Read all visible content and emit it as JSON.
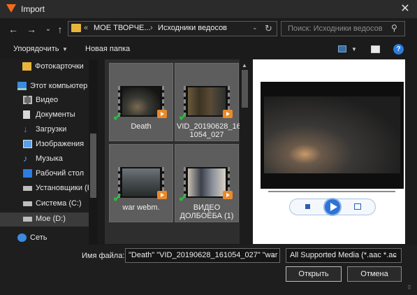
{
  "window": {
    "title": "Import",
    "close_glyph": "✕"
  },
  "nav": {
    "back_glyph": "←",
    "forward_glyph": "→",
    "recent_glyph": "⌄",
    "up_glyph": "↑",
    "path_prefix": "«",
    "path": [
      "МОЕ ТВОРЧЕ...",
      "Исходники ведосов"
    ],
    "path_separator": "›",
    "dropdown_glyph": "⌄",
    "refresh_glyph": "↻"
  },
  "search": {
    "placeholder": "Поиск: Исходники ведосов",
    "icon_glyph": "⚲"
  },
  "toolbar": {
    "organize": "Упорядочить",
    "organize_caret": "▼",
    "new_folder": "Новая папка",
    "view_caret": "▼",
    "help": "?"
  },
  "sidebar": {
    "items": [
      {
        "label": "Фотокарточки",
        "icon": "folder-icon"
      },
      {
        "label": "Этот компьютер",
        "icon": "computer-icon"
      },
      {
        "label": "Видео",
        "icon": "video-folder-icon"
      },
      {
        "label": "Документы",
        "icon": "documents-icon"
      },
      {
        "label": "Загрузки",
        "icon": "downloads-icon"
      },
      {
        "label": "Изображения",
        "icon": "pictures-icon"
      },
      {
        "label": "Музыка",
        "icon": "music-icon"
      },
      {
        "label": "Рабочий стол",
        "icon": "desktop-icon"
      },
      {
        "label": "Установщики (E",
        "icon": "drive-icon"
      },
      {
        "label": "Система (C:)",
        "icon": "drive-icon"
      },
      {
        "label": "Мое (D:)",
        "icon": "drive-icon"
      },
      {
        "label": "Сеть",
        "icon": "network-icon"
      }
    ],
    "selected_index": 10
  },
  "files": [
    {
      "name": "Death",
      "checked": true
    },
    {
      "name": "VID_20190628_161054_027",
      "name_lines": [
        "VID_20190628_16",
        "1054_027"
      ],
      "checked": true
    },
    {
      "name": "war webm.",
      "checked": true
    },
    {
      "name": "ВИДЕО ДОЛБОЁБА (1)",
      "name_lines": [
        "ВИДЕО",
        "ДОЛБОЁБА (1)"
      ],
      "checked": true
    }
  ],
  "check_glyph": "✔",
  "scroll_up_glyph": "▲",
  "footer": {
    "filename_label": "Имя файла:",
    "filename_value": "\"Death\" \"VID_20190628_161054_027\" \"war w",
    "filename_caret": "⌄",
    "filetype_value": "All Supported Media (*.aac *.ac",
    "filetype_caret": "⌄",
    "open": "Открыть",
    "cancel": "Отмена",
    "grip_glyph": "⠿"
  },
  "colors": {
    "accent_orange": "#f26a1b",
    "check_green": "#29c03d",
    "play_blue": "#2f73d6"
  }
}
